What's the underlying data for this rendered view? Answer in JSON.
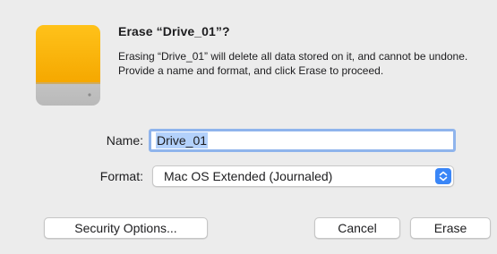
{
  "dialog": {
    "title": "Erase “Drive_01”?",
    "message": "Erasing “Drive_01” will delete all data stored on it, and cannot be undone. Provide a name and format, and click Erase to proceed.",
    "icon": "external-drive-icon",
    "colors": {
      "drive_orange": "#f9b400",
      "drive_gray": "#c9c9c9",
      "focus_ring": "#8fb4ec",
      "accent": "#3a86f7"
    }
  },
  "form": {
    "name_label": "Name:",
    "name_value": "Drive_01",
    "format_label": "Format:",
    "format_value": "Mac OS Extended (Journaled)"
  },
  "buttons": {
    "security": "Security Options...",
    "cancel": "Cancel",
    "erase": "Erase"
  }
}
